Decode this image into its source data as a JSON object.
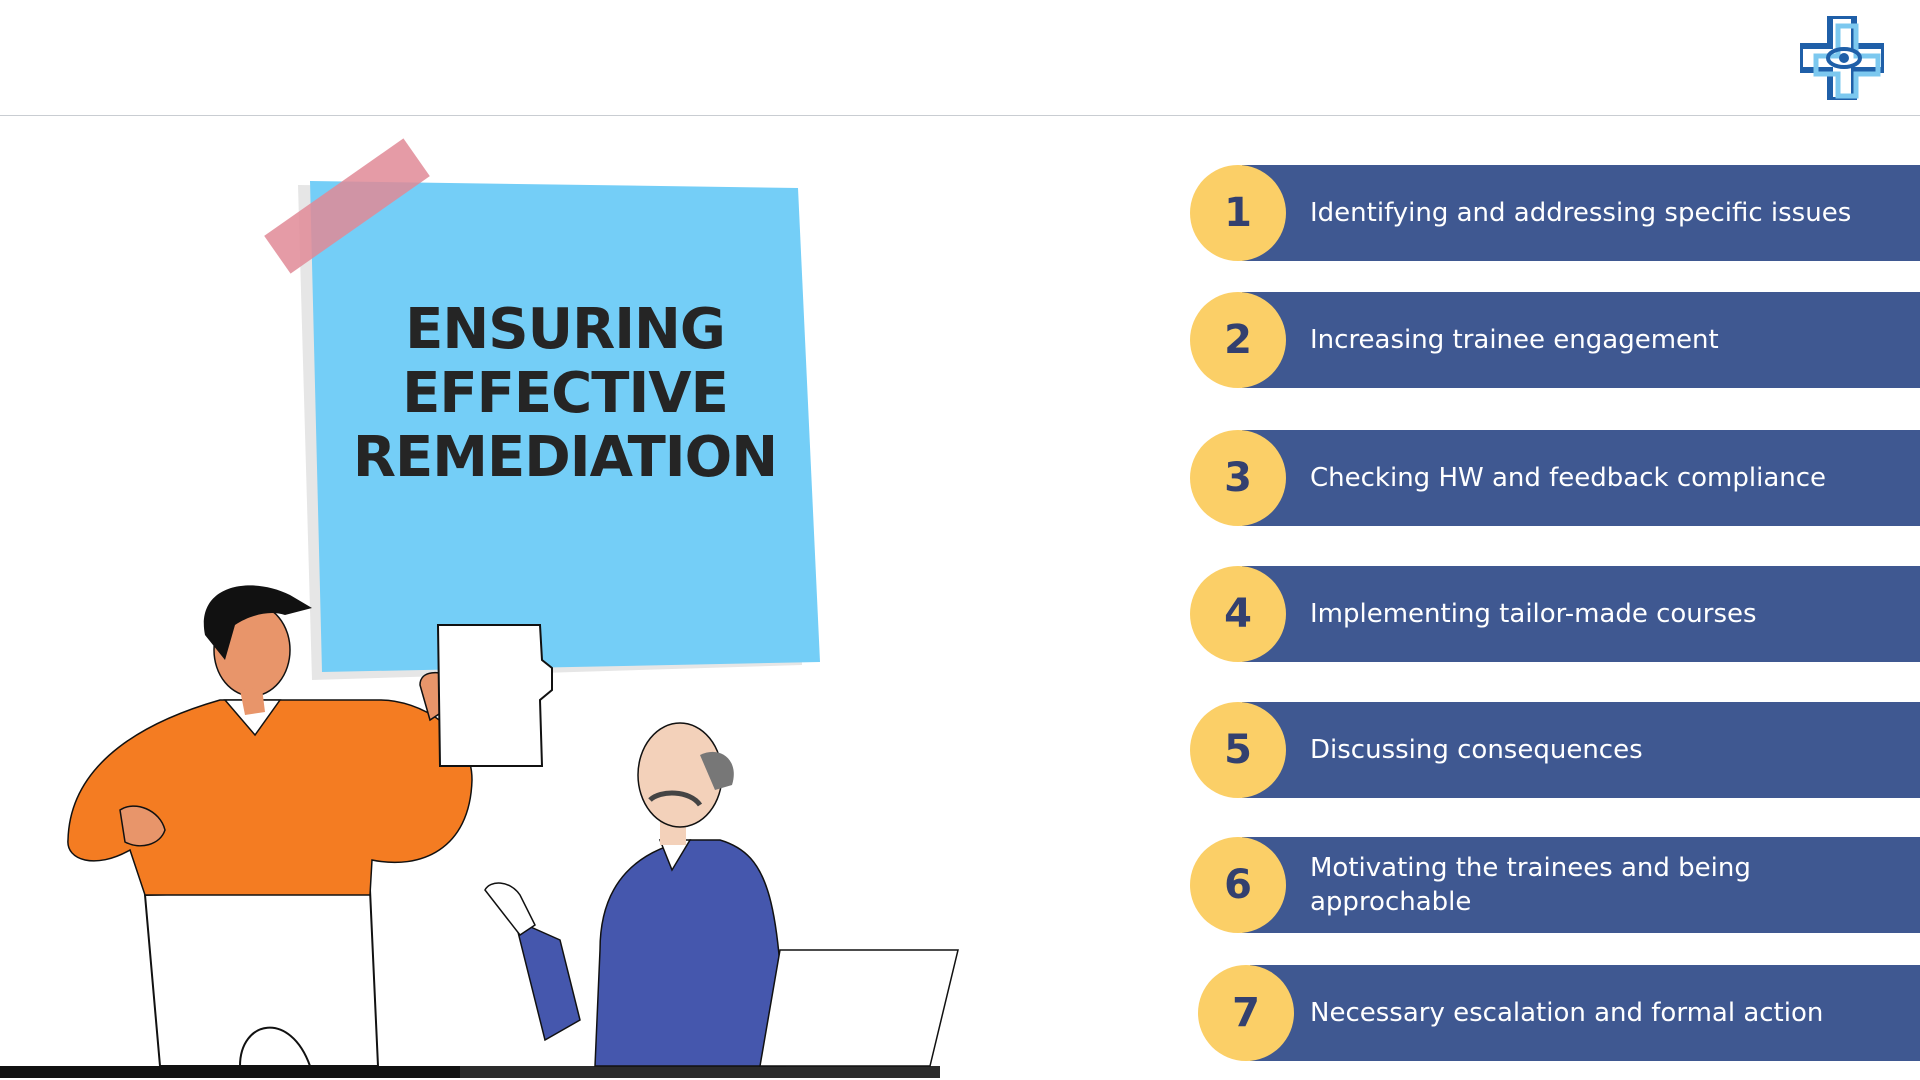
{
  "brand": {
    "logo_icon": "medical-cross-eye-icon",
    "colors": {
      "primary": "#1f5fa8",
      "secondary": "#7cc8ef"
    }
  },
  "note": {
    "title_lines": [
      "ENSURING",
      "EFFECTIVE",
      "REMEDIATION"
    ],
    "color": "#74cef7",
    "tape_color": "#e08a96"
  },
  "list": {
    "bar_color": "#3f5891",
    "circle_color": "#fbcf67",
    "number_color": "#33406f",
    "items": [
      {
        "number": "1",
        "text": "Identifying and addressing specific issues"
      },
      {
        "number": "2",
        "text": "Increasing trainee engagement"
      },
      {
        "number": "3",
        "text": "Checking HW and feedback compliance"
      },
      {
        "number": "4",
        "text": "Implementing tailor-made courses"
      },
      {
        "number": "5",
        "text": "Discussing consequences"
      },
      {
        "number": "6",
        "text": "Motivating the trainees and being approchable"
      },
      {
        "number": "7",
        "text": "Necessary escalation and formal action"
      }
    ]
  },
  "illustration": {
    "people": [
      "man-holding-paper",
      "older-man-at-laptop"
    ],
    "shirt_colors": {
      "standing_man": "#f47c22",
      "seated_man": "#4557ad"
    }
  }
}
